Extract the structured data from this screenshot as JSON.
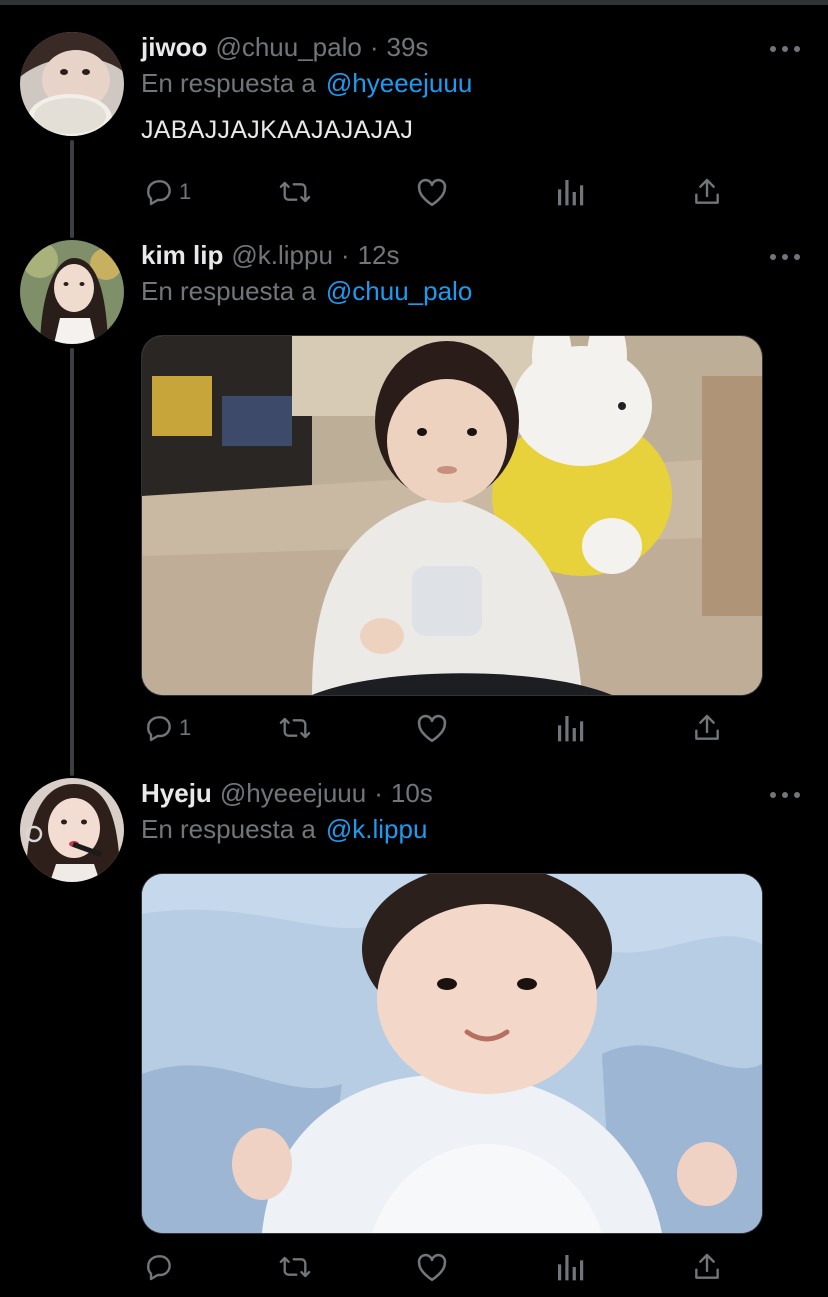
{
  "tweets": [
    {
      "name": "jiwoo",
      "handle": "@chuu_palo",
      "separator": "·",
      "time": "39s",
      "reply_prefix": "En respuesta a",
      "reply_to": "@hyeeejuuu",
      "text": "JABAJJAJKAAJAJAJAJ",
      "reply_count": "1"
    },
    {
      "name": "kim lip",
      "handle": "@k.lippu",
      "separator": "·",
      "time": "12s",
      "reply_prefix": "En respuesta a",
      "reply_to": "@chuu_palo",
      "reply_count": "1"
    },
    {
      "name": "Hyeju",
      "handle": "@hyeeejuuu",
      "separator": "·",
      "time": "10s",
      "reply_prefix": "En respuesta a",
      "reply_to": "@k.lippu",
      "reply_count": ""
    }
  ],
  "icons": [
    "more-icon",
    "reply-icon",
    "retweet-icon",
    "like-icon",
    "analytics-icon",
    "share-icon"
  ],
  "colors": {
    "background": "#000000",
    "text": "#e7e9ea",
    "muted": "#71767b",
    "link": "#1d9bf0",
    "thread_line": "#3a3f44"
  }
}
